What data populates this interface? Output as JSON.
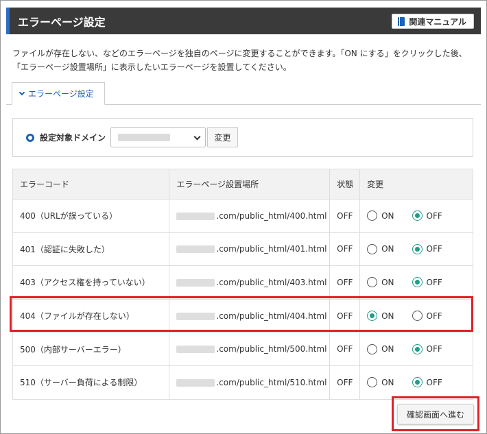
{
  "header": {
    "title": "エラーページ設定",
    "manual_label": "関連マニュアル"
  },
  "description": {
    "line1": "ファイルが存在しない、などのエラーページを独自のページに変更することができます。「ON にする」をクリックした後、",
    "line2": "「エラーページ設置場所」に表示したいエラーページを設置してください。"
  },
  "tab": {
    "label": "エラーページ設定"
  },
  "domain": {
    "label": "設定対象ドメイン",
    "change_label": "変更"
  },
  "table": {
    "headers": [
      "エラーコード",
      "エラーページ設置場所",
      "状態",
      "変更"
    ],
    "on_label": "ON",
    "off_label": "OFF",
    "rows": [
      {
        "code": "400（URLが誤っている）",
        "path": ".com/public_html/400.html",
        "state": "OFF",
        "selected": "OFF"
      },
      {
        "code": "401（認証に失敗した）",
        "path": ".com/public_html/401.html",
        "state": "OFF",
        "selected": "OFF"
      },
      {
        "code": "403（アクセス権を持っていない）",
        "path": ".com/public_html/403.html",
        "state": "OFF",
        "selected": "OFF"
      },
      {
        "code": "404（ファイルが存在しない）",
        "path": ".com/public_html/404.html",
        "state": "OFF",
        "selected": "ON"
      },
      {
        "code": "500（内部サーバーエラー）",
        "path": ".com/public_html/500.html",
        "state": "OFF",
        "selected": "OFF"
      },
      {
        "code": "510（サーバー負荷による制限）",
        "path": ".com/public_html/510.html",
        "state": "OFF",
        "selected": "OFF"
      }
    ]
  },
  "confirm_label": "確認画面へ進む",
  "colors": {
    "header_bg": "#3a3a3a",
    "accent_blue": "#1f63b8",
    "radio_teal": "#1f9e8a",
    "highlight_red": "#e0202a"
  }
}
